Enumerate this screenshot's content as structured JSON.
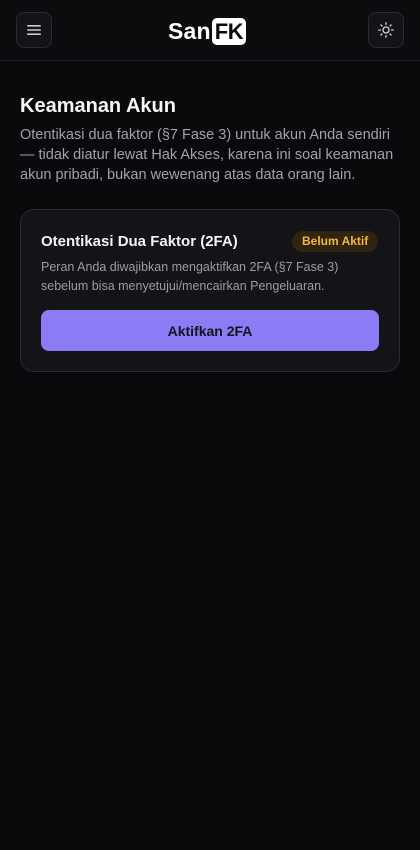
{
  "header": {
    "logo": {
      "part1": "San",
      "part2": "FK"
    },
    "menu_icon": "hamburger-menu-icon",
    "theme_icon": "sun-icon"
  },
  "page": {
    "title": "Keamanan Akun",
    "description": "Otentikasi dua faktor (§7 Fase 3) untuk akun Anda sendiri — tidak diatur lewat Hak Akses, karena ini soal keamanan akun pribadi, bukan wewenang atas data orang lain."
  },
  "two_factor_card": {
    "title": "Otentikasi Dua Faktor (2FA)",
    "status_badge": "Belum Aktif",
    "description": "Peran Anda diwajibkan mengaktifkan 2FA (§7 Fase 3) sebelum bisa menyetujui/mencairkan Pengeluaran.",
    "button_label": "Aktifkan 2FA"
  },
  "colors": {
    "background": "#0a0a0c",
    "accent": "#8b7cf6",
    "warning": "#f5b73b"
  }
}
